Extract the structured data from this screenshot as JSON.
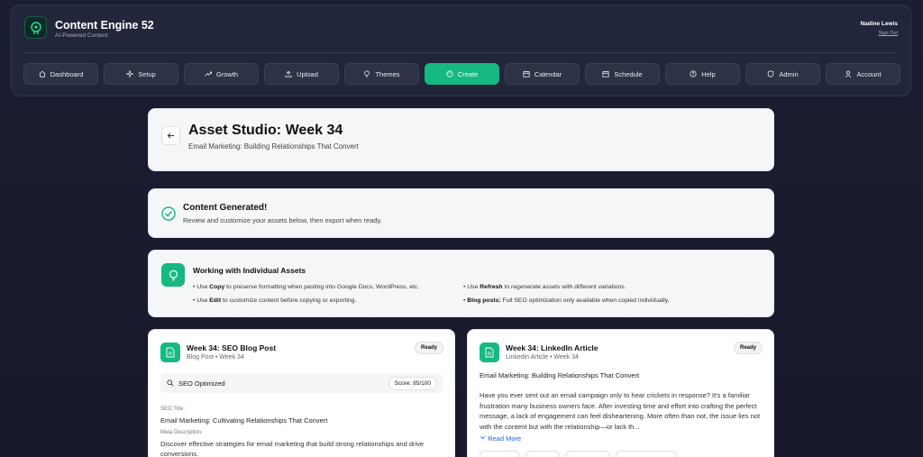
{
  "app": {
    "title": "Content Engine 52",
    "subtitle": "AI-Powered Content"
  },
  "user": {
    "name": "Nadine Lewis",
    "signout": "Sign Out"
  },
  "nav": [
    {
      "label": "Dashboard",
      "icon": "home-icon"
    },
    {
      "label": "Setup",
      "icon": "sparkle-icon"
    },
    {
      "label": "Growth",
      "icon": "trend-icon"
    },
    {
      "label": "Upload",
      "icon": "upload-icon"
    },
    {
      "label": "Themes",
      "icon": "bulb-icon"
    },
    {
      "label": "Create",
      "icon": "palette-icon",
      "active": true
    },
    {
      "label": "Calendar",
      "icon": "calendar-icon"
    },
    {
      "label": "Schedule",
      "icon": "calendar-icon"
    },
    {
      "label": "Help",
      "icon": "help-icon"
    },
    {
      "label": "Admin",
      "icon": "shield-icon"
    },
    {
      "label": "Account",
      "icon": "user-icon"
    }
  ],
  "header": {
    "title_prefix": "Asset Studio: ",
    "title_week": "Week 34",
    "subtitle": "Email Marketing: Building Relationships That Convert"
  },
  "generated": {
    "title": "Content Generated!",
    "subtitle": "Review and customize your assets below, then export when ready."
  },
  "tips": {
    "title": "Working with Individual Assets",
    "copy": {
      "pre": "• Use ",
      "bold": "Copy",
      "post": " to preserve formatting when pasting into Google Docs, WordPress, etc."
    },
    "edit": {
      "pre": "• Use ",
      "bold": "Edit",
      "post": " to customize content before copying or exporting."
    },
    "refresh": {
      "pre": "• Use ",
      "bold": "Refresh",
      "post": " to regenerate assets with different variations."
    },
    "blog": {
      "pre": "• ",
      "bold": "Blog posts:",
      "post": " Full SEO optimization only available when copied individually."
    }
  },
  "blog": {
    "title": "Week 34: SEO Blog Post",
    "sub": "Blog Post • Week 34",
    "badge": "Ready",
    "seo_label": "SEO Optimized",
    "score": "Score: 85/100",
    "seo_title_label": "SEO Title:",
    "seo_title": "Email Marketing: Cultivating Relationships That Convert",
    "meta_label": "Meta Description:",
    "meta": "Discover effective strategies for email marketing that build strong relationships and drive conversions."
  },
  "linkedin": {
    "title": "Week 34: LinkedIn Article",
    "sub": "Linkedin Article • Week 34",
    "badge": "Ready",
    "headline": "Email Marketing: Building Relationships That Convert",
    "body": "Have you ever sent out an email campaign only to hear crickets in response? It's a familiar frustration many business owners face. After investing time and effort into crafting the perfect message, a lack of engagement can feel disheartening. More often than not, the issue lies not with the content but with the relationship—or lack th...",
    "read_more": "Read More"
  },
  "colors": {
    "accent": "#16b981",
    "bg": "#1b1e33"
  }
}
